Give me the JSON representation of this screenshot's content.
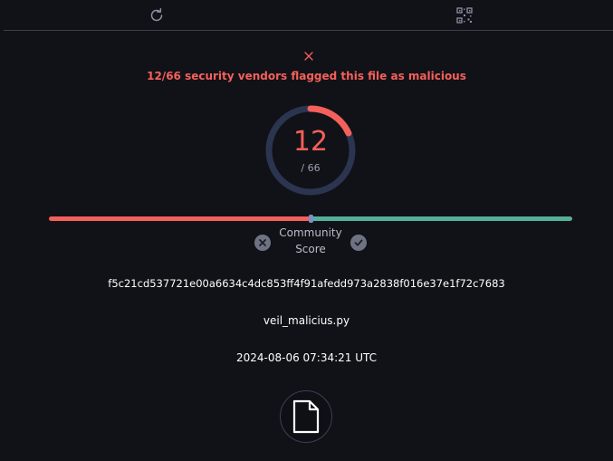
{
  "toolbar": {
    "reload_icon": "reload-icon",
    "qr_icon": "qr-code-icon"
  },
  "detection": {
    "close_icon": "close-icon",
    "summary": "12/66 security vendors flagged this file as malicious",
    "flagged": 12,
    "total_label": "/ 66",
    "total": 66,
    "gauge_color": "#f5605a"
  },
  "community": {
    "label_line1": "Community",
    "label_line2": "Score",
    "score_position": 0.5,
    "negative_color": "#f5605a",
    "positive_color": "#55b09b"
  },
  "file": {
    "sha256": "f5c21cd537721e00a6634c4dc853ff4f91afedd973a2838f016e37e1f72c7683",
    "name": "veil_malicius.py",
    "date": "2024-08-06 07:34:21 UTC",
    "icon": "file-icon"
  }
}
